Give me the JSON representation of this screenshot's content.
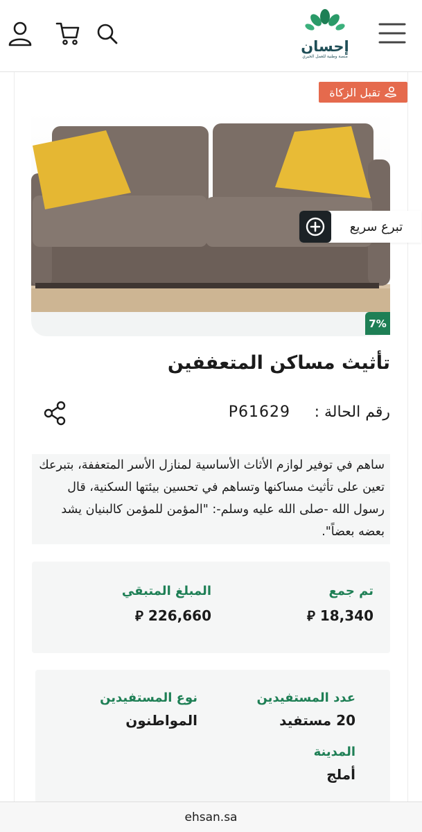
{
  "header": {
    "logo_text": "إحسان",
    "logo_subtitle": "منصة وطنية للعمل الخيري",
    "icons": [
      "user-icon",
      "cart-icon",
      "search-icon",
      "menu-icon"
    ]
  },
  "zakat_badge": {
    "label": "تقبل الزكاة",
    "color": "#e56a4d"
  },
  "progress": {
    "label": "7%",
    "value": 7
  },
  "quick_donate": {
    "label": "تبرع سريع"
  },
  "case": {
    "title": "تأثيث مساكن المتعففين",
    "number_label": "رقم الحالة :",
    "number": "P61629",
    "description": "ساهم في توفير لوازم الأثاث الأساسية لمنازل الأسر المتعففة، بتبرعك تعين على تأثيث مساكنها وتساهم في تحسين بيئتها السكنية، قال رسول الله -صلى الله عليه وسلم-: \"المؤمن للمؤمن كالبنيان يشد بعضه بعضاً\"."
  },
  "stats": {
    "collected_label": "تم جمع",
    "collected_value": "18,340",
    "remaining_label": "المبلغ المتبقي",
    "remaining_value": "226,660",
    "currency_symbol": "⃁"
  },
  "details": {
    "beneficiaries_count_label": "عدد المستفيدين",
    "beneficiaries_count_value": "20 مستفيد",
    "beneficiaries_type_label": "نوع المستفيدين",
    "beneficiaries_type_value": "المواطنون",
    "city_label": "المدينة",
    "city_value": "أملج"
  },
  "footer": {
    "url": "ehsan.sa"
  },
  "colors": {
    "accent_green": "#1e7f55",
    "logo_teal": "#1f4e57",
    "zakat_orange": "#e56a4d"
  }
}
